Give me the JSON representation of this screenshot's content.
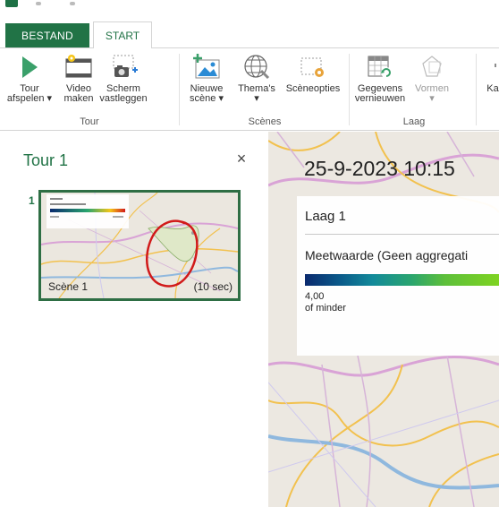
{
  "tabs": {
    "file": "BESTAND",
    "home": "START"
  },
  "ribbon": {
    "tour_group": {
      "label": "Tour",
      "play_tour": [
        "Tour",
        "afspelen ▾"
      ],
      "make_video": [
        "Video",
        "maken"
      ],
      "capture_screen": [
        "Scherm",
        "vastleggen"
      ]
    },
    "scenes_group": {
      "label": "Scènes",
      "new_scene": [
        "Nieuwe",
        "scène ▾"
      ],
      "themes": [
        "Thema's",
        "▾"
      ],
      "scene_options": [
        "Scèneopties"
      ]
    },
    "layer_group": {
      "label": "Laag",
      "refresh_data": [
        "Gegevens",
        "vernieuwen"
      ],
      "shapes": [
        "Vormen",
        "▾"
      ]
    },
    "truncated_button": "Ka"
  },
  "tour_pane": {
    "title": "Tour 1",
    "close": "×",
    "scene_number": "1",
    "scene_label": "Scène 1",
    "scene_duration": "(10 sec)"
  },
  "map": {
    "timestamp": "25-9-2023 10:15",
    "legend": {
      "layer_name": "Laag 1",
      "measure_label": "Meetwaarde (Geen aggregati",
      "min_value": "4,00",
      "min_caption": "of minder"
    }
  },
  "colors": {
    "accent": "#217346",
    "annotation": "#d11a1a"
  }
}
